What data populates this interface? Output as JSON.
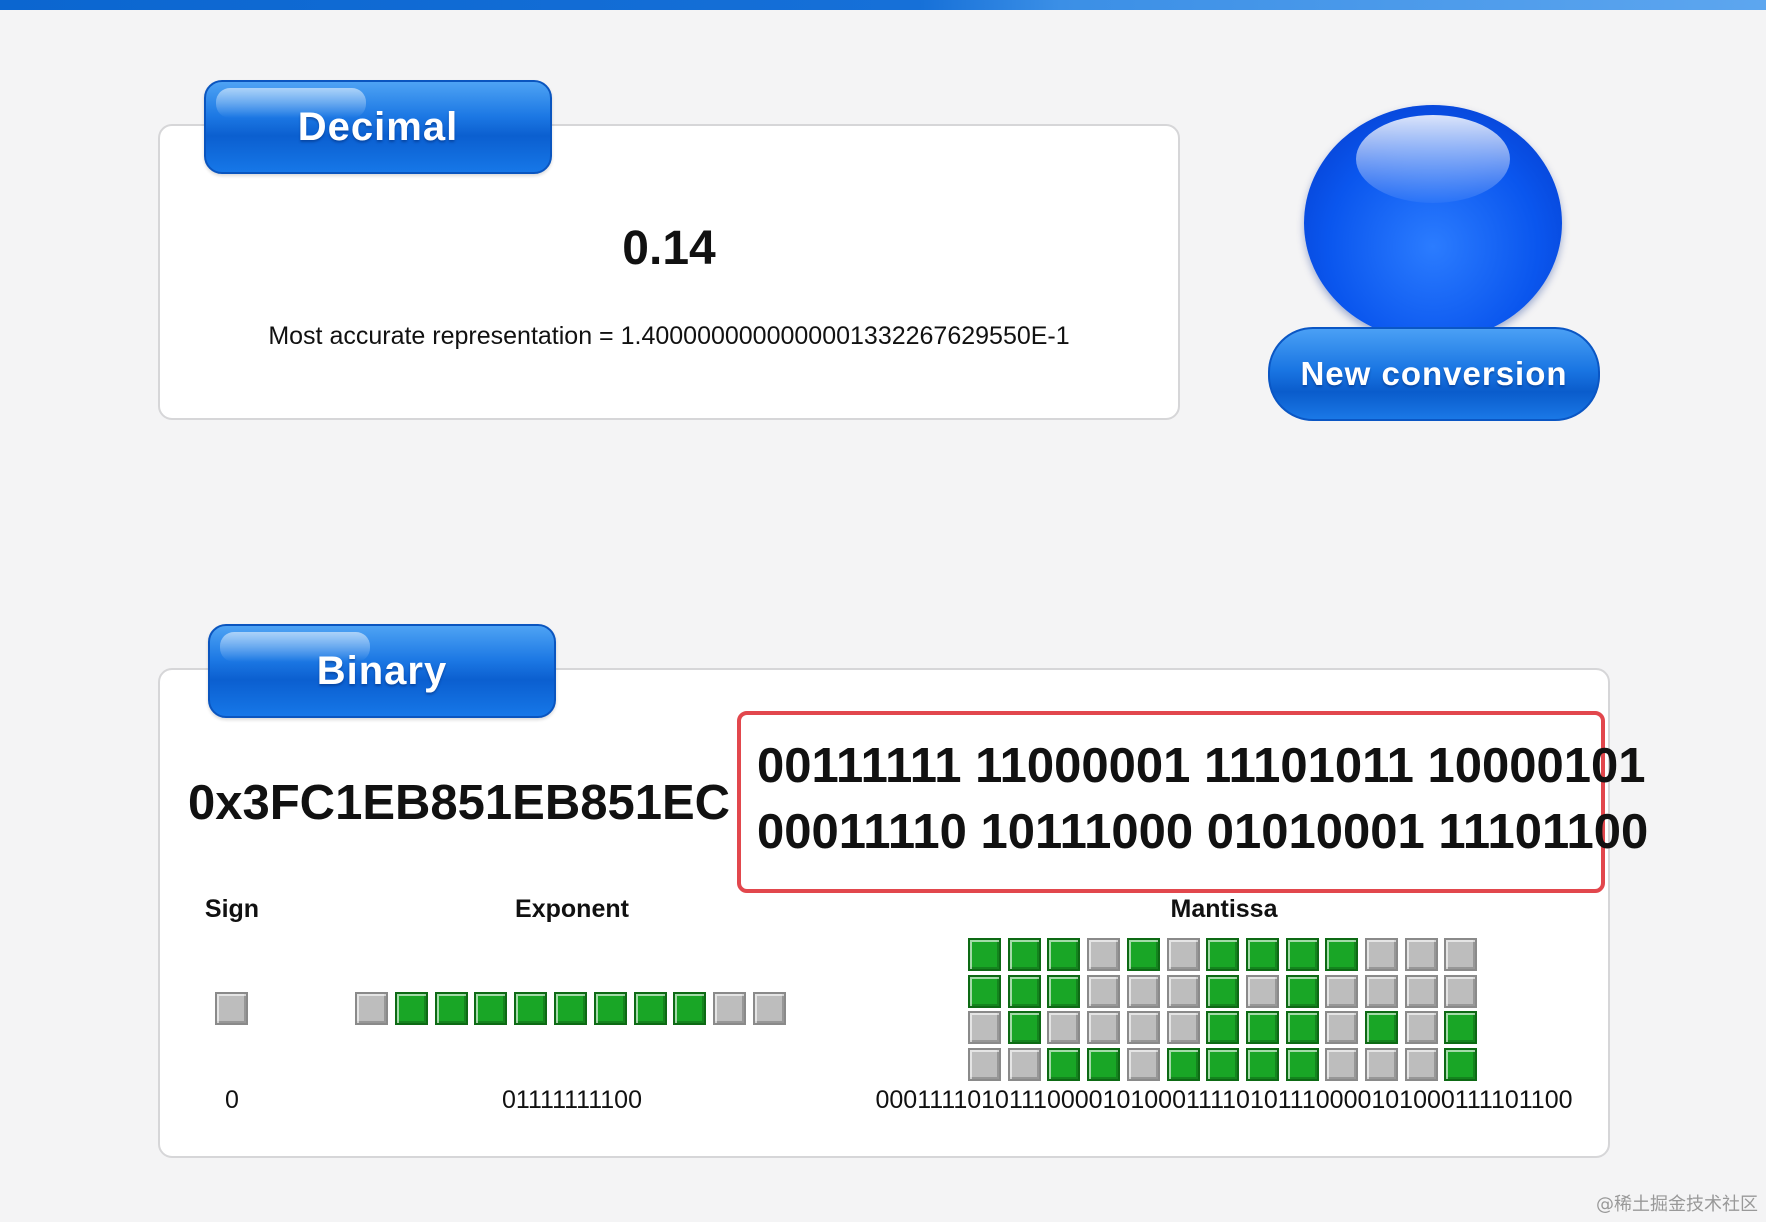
{
  "decimal": {
    "tab_label": "Decimal",
    "value": "0.14",
    "accurate_representation": "Most accurate representation = 1.4000000000000001332267629550E-1"
  },
  "new_conversion_label": "New conversion",
  "binary": {
    "tab_label": "Binary",
    "hex": "0x3FC1EB851EB851EC =",
    "bit_lines": [
      "00111111 11000001 11101011 10000101",
      "00011110 10111000 01010001 11101100"
    ],
    "sign_label": "Sign",
    "exponent_label": "Exponent",
    "mantissa_label": "Mantissa",
    "sign_bits": "0",
    "exponent_bits": "01111111100",
    "mantissa_bits": "0001111010111000010100011110101110000101000111101100"
  },
  "colors": {
    "bit_on": "#19a626",
    "bit_off": "#bdbdbd",
    "accent": "#1670d8",
    "highlight": "#e2474d"
  },
  "watermark": "@稀土掘金技术社区"
}
